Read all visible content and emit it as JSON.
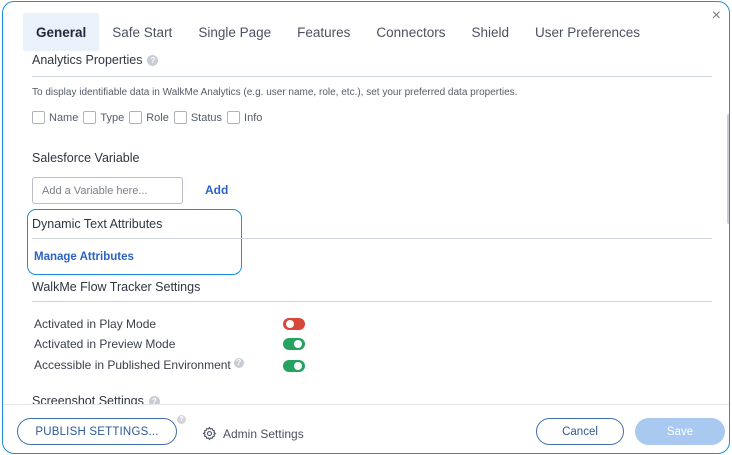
{
  "tabs": [
    {
      "label": "General",
      "active": true
    },
    {
      "label": "Safe Start",
      "active": false
    },
    {
      "label": "Single Page",
      "active": false
    },
    {
      "label": "Features",
      "active": false
    },
    {
      "label": "Connectors",
      "active": false
    },
    {
      "label": "Shield",
      "active": false
    },
    {
      "label": "User Preferences",
      "active": false
    }
  ],
  "close_glyph": "×",
  "analytics": {
    "heading": "Analytics Properties",
    "info_glyph": "?",
    "description": "To display identifiable data in WalkMe Analytics (e.g. user name, role, etc.), set your preferred data properties.",
    "options": [
      "Name",
      "Type",
      "Role",
      "Status",
      "Info"
    ]
  },
  "salesforce": {
    "heading": "Salesforce Variable",
    "placeholder": "Add a Variable here...",
    "add_label": "Add"
  },
  "dynamic_text": {
    "heading": "Dynamic Text Attributes",
    "link": "Manage Attributes"
  },
  "flow_tracker": {
    "heading": "WalkMe Flow Tracker Settings",
    "settings": [
      {
        "label": "Activated in Play Mode",
        "enabled": false,
        "has_info": false
      },
      {
        "label": "Activated in Preview Mode",
        "enabled": true,
        "has_info": false
      },
      {
        "label": "Accessible in Published Environment",
        "enabled": true,
        "has_info": true
      }
    ]
  },
  "screenshot": {
    "heading": "Screenshot Settings"
  },
  "footer": {
    "publish_label": "PUBLISH SETTINGS...",
    "admin_label": "Admin Settings",
    "cancel_label": "Cancel",
    "save_label": "Save"
  },
  "colors": {
    "accent": "#1e90d6",
    "link": "#2a63c5",
    "toggle_on": "#27a361",
    "toggle_off": "#d9473b",
    "save_disabled": "#a9c9f0"
  },
  "icons": {
    "close": "close-icon",
    "info": "info-icon",
    "admin": "gear-icon"
  }
}
